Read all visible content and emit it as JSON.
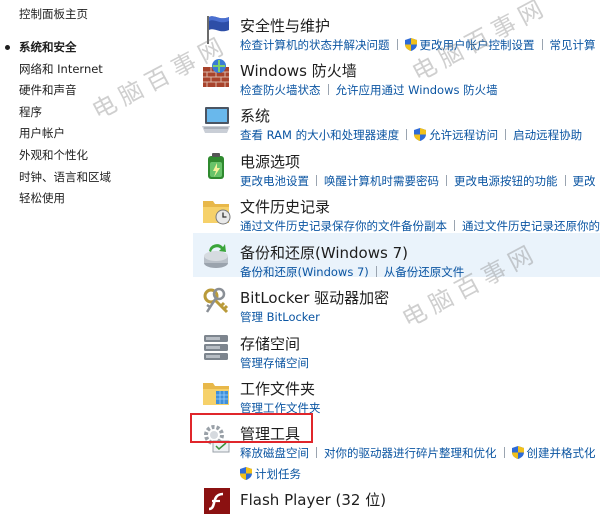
{
  "sidebar": {
    "home": "控制面板主页",
    "items": [
      {
        "label": "系统和安全",
        "active": true
      },
      {
        "label": "网络和 Internet"
      },
      {
        "label": "硬件和声音"
      },
      {
        "label": "程序"
      },
      {
        "label": "用户帐户"
      },
      {
        "label": "外观和个性化"
      },
      {
        "label": "时钟、语言和区域"
      },
      {
        "label": "轻松使用"
      }
    ]
  },
  "categories": {
    "security": {
      "title": "安全性与维护",
      "icon": "flag-icon",
      "link1": "检查计算机的状态并解决问题",
      "link2": "更改用户帐户控制设置",
      "link3": "常见计算"
    },
    "firewall": {
      "title": "Windows 防火墙",
      "icon": "brick-wall-icon",
      "link1": "检查防火墙状态",
      "link2": "允许应用通过 Windows 防火墙"
    },
    "system": {
      "title": "系统",
      "icon": "computer-icon",
      "link1": "查看 RAM 的大小和处理器速度",
      "link2": "允许远程访问",
      "link3": "启动远程协助"
    },
    "power": {
      "title": "电源选项",
      "icon": "battery-icon",
      "link1": "更改电池设置",
      "link2": "唤醒计算机时需要密码",
      "link3": "更改电源按钮的功能",
      "link4": "更改"
    },
    "filehistory": {
      "title": "文件历史记录",
      "icon": "folder-clock-icon",
      "link1": "通过文件历史记录保存你的文件备份副本",
      "link2": "通过文件历史记录还原你的"
    },
    "backup": {
      "title": "备份和还原(Windows 7)",
      "icon": "backup-icon",
      "link1": "备份和还原(Windows 7)",
      "link2": "从备份还原文件"
    },
    "bitlocker": {
      "title": "BitLocker 驱动器加密",
      "icon": "keys-icon",
      "link1": "管理 BitLocker"
    },
    "storage": {
      "title": "存储空间",
      "icon": "storage-icon",
      "link1": "管理存储空间"
    },
    "workfolders": {
      "title": "工作文件夹",
      "icon": "work-folder-icon",
      "link1": "管理工作文件夹"
    },
    "admintools": {
      "title": "管理工具",
      "icon": "admin-tools-icon",
      "link1": "释放磁盘空间",
      "link2": "对你的驱动器进行碎片整理和优化",
      "link3": "创建并格式化",
      "link4": "计划任务"
    },
    "flash": {
      "title": "Flash Player (32 位)",
      "icon": "flash-icon"
    }
  },
  "watermark": {
    "text1": "电脑百事网",
    "text2": "电脑百事网",
    "text3": "电脑百事网"
  },
  "colors": {
    "link": "#0b55a2",
    "highlight_row": "#eaf3fb",
    "annotation_box": "#e0262b"
  }
}
